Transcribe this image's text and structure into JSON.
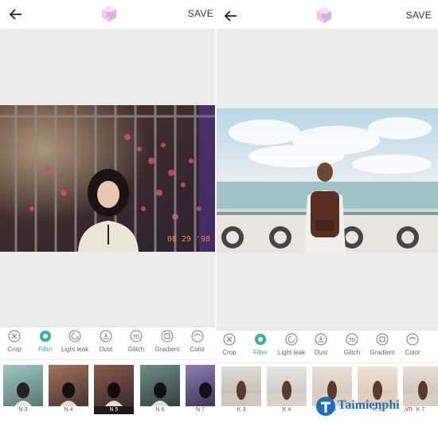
{
  "left_screen": {
    "save_label": "SAVE",
    "timestamp": "08 29 '98",
    "tools": [
      {
        "label": "Crop",
        "icon": "crop-icon"
      },
      {
        "label": "Filter",
        "icon": "filter-icon"
      },
      {
        "label": "Light leak",
        "icon": "light-leak-icon"
      },
      {
        "label": "Dust",
        "icon": "dust-icon"
      },
      {
        "label": "Glitch",
        "icon": "glitch-icon"
      },
      {
        "label": "Gradient",
        "icon": "gradient-icon"
      },
      {
        "label": "Color",
        "icon": "color-icon"
      }
    ],
    "active_tool": "Filter",
    "filters": [
      "N 3",
      "N 4",
      "N 5",
      "N 6",
      "N 7"
    ],
    "selected_filter": "N 5"
  },
  "right_screen": {
    "save_label": "SAVE",
    "tools": [
      {
        "label": "Crop",
        "icon": "crop-icon"
      },
      {
        "label": "Filter",
        "icon": "filter-icon"
      },
      {
        "label": "Light leak",
        "icon": "light-leak-icon"
      },
      {
        "label": "Dust",
        "icon": "dust-icon"
      },
      {
        "label": "Glitch",
        "icon": "glitch-icon"
      },
      {
        "label": "Gradient",
        "icon": "gradient-icon"
      },
      {
        "label": "Color",
        "icon": "color-icon"
      }
    ],
    "active_tool": "Filter",
    "filters": [
      "K 3",
      "K 4",
      "K 5",
      "K 6",
      "K 7"
    ]
  },
  "watermark": {
    "text": "Taimienphi",
    "suffix": ".vn"
  },
  "colors": {
    "accent": "#2fb59a",
    "timestamp": "#ff8a2a",
    "watermark_blue": "#1c6fb8",
    "watermark_red": "#d8322b"
  }
}
